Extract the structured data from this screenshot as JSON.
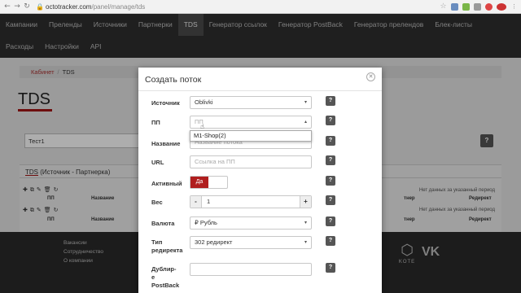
{
  "browser": {
    "url_host": "octotracker.com",
    "url_path": "/panel/manage/tds",
    "back_icon": "arrow-left",
    "forward_icon": "arrow-right",
    "reload_icon": "reload"
  },
  "nav": {
    "row1": [
      "Кампании",
      "Преленды",
      "Источники",
      "Партнерки",
      "TDS",
      "Генератор ссылок",
      "Генератор PostBack",
      "Генератор прелендов",
      "Блек-листы"
    ],
    "row2": [
      "Расходы",
      "Настройки",
      "API"
    ],
    "active": "TDS"
  },
  "breadcrumb": {
    "home": "Кабинет",
    "current": "TDS"
  },
  "page": {
    "heading": "TDS",
    "stream_name": "Тест1",
    "help": "?"
  },
  "panel": {
    "title_link": "TDS",
    "title_rest": " (Источник - Партнерка)",
    "no_data": "Нет данных за указанный период",
    "col_pp": "ПП",
    "col_name": "Название",
    "col_partner": "тнер",
    "col_redirect": "Редирект"
  },
  "footer": {
    "links": [
      "Вакансии",
      "Сотрудничество",
      "О компании"
    ],
    "kote_label": "KOTE",
    "vk_label": "VK"
  },
  "modal": {
    "title": "Создать поток",
    "source_label": "Источник",
    "source_value": "Oblivki",
    "pp_label": "ПП",
    "pp_placeholder": "ПП",
    "pp_option": "M1-Shop(2)",
    "name_label": "Название",
    "name_placeholder": "Название потока",
    "url_label": "URL",
    "url_placeholder": "Ссылка на ПП",
    "active_label": "Активный",
    "active_on": "Да",
    "weight_label": "Вес",
    "weight_minus": "-",
    "weight_value": "1",
    "weight_plus": "+",
    "currency_label": "Валюта",
    "currency_value": "₽ Рубль",
    "redirect_label_1": "Тип",
    "redirect_label_2": "редиректа",
    "redirect_value": "302 редирект",
    "dup_label_1": "Дублир-",
    "dup_label_2": "е",
    "dup_label_3": "PostBack",
    "help": "?"
  }
}
